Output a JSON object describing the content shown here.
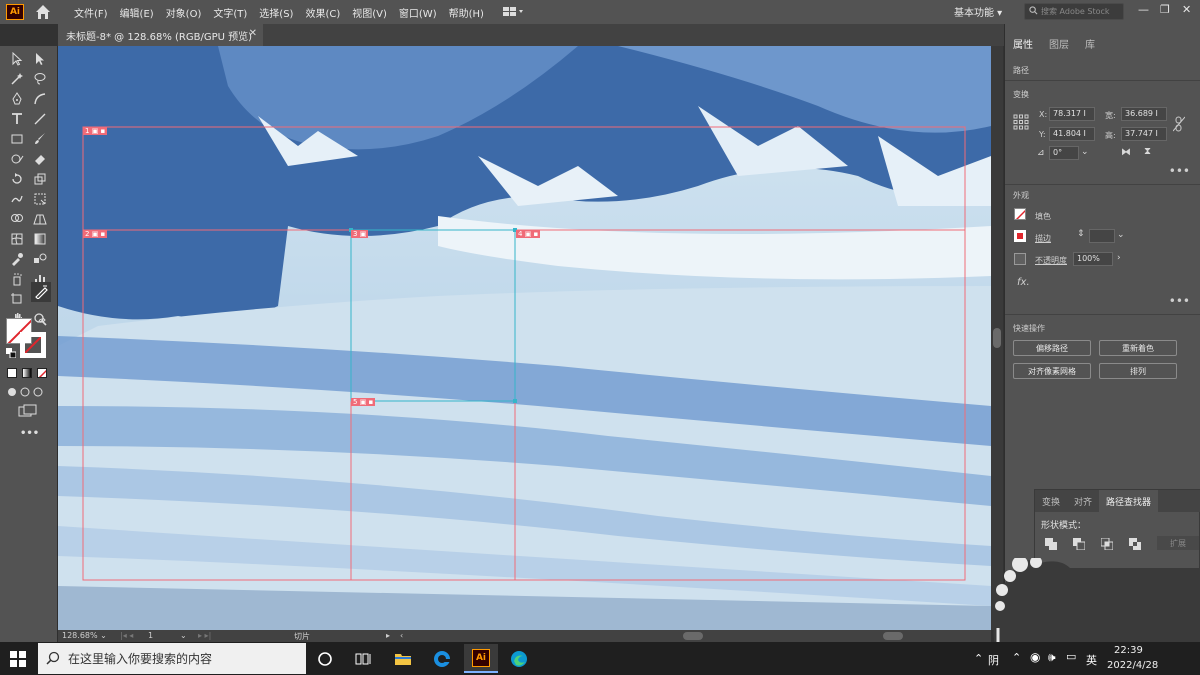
{
  "app": {
    "logo": "Ai",
    "colors": {
      "accent": "#ff9a00",
      "slice": "#f06b78",
      "selection": "#35b5c9"
    }
  },
  "menubar": {
    "items": [
      "文件(F)",
      "编辑(E)",
      "对象(O)",
      "文字(T)",
      "选择(S)",
      "效果(C)",
      "视图(V)",
      "窗口(W)",
      "帮助(H)"
    ],
    "workspace": "基本功能 ▾",
    "search_placeholder": "搜索 Adobe Stock",
    "window_controls": [
      "—",
      "❐",
      "✕"
    ]
  },
  "document": {
    "tab_title": "未标题-8* @ 128.68% (RGB/GPU 预览)",
    "close": "✕"
  },
  "canvas": {
    "slices": [
      "1",
      "2",
      "3",
      "4",
      "5"
    ]
  },
  "statusbar": {
    "zoom": "128.68%",
    "page": "1",
    "tool": "切片"
  },
  "properties": {
    "tabs": [
      "属性",
      "图层",
      "库"
    ],
    "path_label": "路径",
    "transform": {
      "title": "变换",
      "x_label": "X:",
      "x": "78.317 I",
      "y_label": "Y:",
      "y": "41.804 I",
      "w_label": "宽:",
      "w": "36.689 I",
      "h_label": "高:",
      "h": "37.747 I",
      "angle": "0°"
    },
    "appearance": {
      "title": "外观",
      "fill": "填色",
      "stroke": "描边",
      "opacity_label": "不透明度",
      "opacity": "100%",
      "fx": "fx."
    },
    "quick_actions": {
      "title": "快速操作",
      "buttons": [
        "偏移路径",
        "重新着色",
        "对齐像素网格",
        "排列"
      ]
    },
    "more": "•••"
  },
  "pathfinder": {
    "tabs": [
      "变换",
      "对齐",
      "路径查找器"
    ],
    "shape_modes": "形状模式：",
    "expand": "扩展"
  },
  "taskbar": {
    "search_placeholder": "在这里输入你要搜索的内容",
    "weather": "阴",
    "ime": "英",
    "time": "22:39",
    "date": "2022/4/28"
  }
}
